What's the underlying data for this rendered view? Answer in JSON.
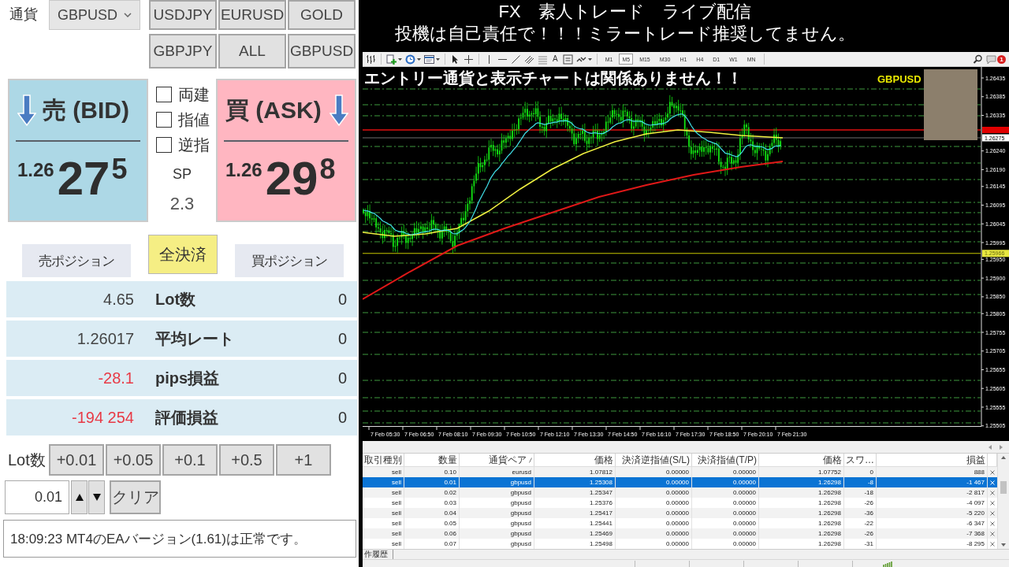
{
  "stream_header": {
    "title": "FX　素人トレード　ライブ配信",
    "subtitle": "投機は自己責任で！！！ミラートレード推奨してません。"
  },
  "order_panel": {
    "currency_label": "通貨",
    "currency_select": {
      "value": "GBPUSD"
    },
    "symbol_buttons": [
      "USDJPY",
      "EURUSD",
      "GOLD",
      "GBPJPY",
      "ALL",
      "GBPUSD"
    ],
    "bid": {
      "label": "売 (BID)",
      "price_prefix": "1.26",
      "price_main": "27",
      "price_pip": "5"
    },
    "order_options": [
      {
        "label": "両建",
        "checked": false
      },
      {
        "label": "指値",
        "checked": false
      },
      {
        "label": "逆指",
        "checked": false
      }
    ],
    "spread": {
      "label": "SP",
      "value": "2.3"
    },
    "ask": {
      "label": "買 (ASK)",
      "price_prefix": "1.26",
      "price_main": "29",
      "price_pip": "8"
    },
    "position_buttons": [
      {
        "label": "売ポジション",
        "kind": "sell"
      },
      {
        "label": "全決済",
        "kind": "close_all"
      },
      {
        "label": "買ポジション",
        "kind": "buy"
      }
    ],
    "summary_rows": [
      {
        "value": "4.65",
        "label": "Lot数",
        "count": "0",
        "negative": false
      },
      {
        "value": "1.26017",
        "label": "平均レート",
        "count": "0",
        "negative": false
      },
      {
        "value": "-28.1",
        "label": "pips損益",
        "count": "0",
        "negative": true
      },
      {
        "value": "-194 254",
        "label": "評価損益",
        "count": "0",
        "negative": true
      }
    ],
    "lot": {
      "label": "Lot数",
      "increments": [
        "+0.01",
        "+0.05",
        "+0.1",
        "+0.5",
        "+1"
      ],
      "value": "0.01",
      "clear_button": "クリア"
    },
    "status_message": "18:09:23 MT4のEAバージョン(1.61)は正常です。"
  },
  "terminal": {
    "toolbar": {
      "text_tool": "A",
      "timeframes": [
        {
          "label": "M1",
          "selected": false
        },
        {
          "label": "M5",
          "selected": true
        },
        {
          "label": "M15",
          "selected": false
        },
        {
          "label": "M30",
          "selected": false
        },
        {
          "label": "H1",
          "selected": false
        },
        {
          "label": "H4",
          "selected": false
        },
        {
          "label": "D1",
          "selected": false
        },
        {
          "label": "W1",
          "selected": false
        },
        {
          "label": "MN",
          "selected": false
        }
      ],
      "notification_count": "1"
    },
    "chart": {
      "overlay_note": "エントリー通貨と表示チャートは関係ありません！！",
      "symbol": "GBPUSD",
      "price_labels": [
        "1.26435",
        "1.26385",
        "1.26335",
        "1.26240",
        "1.26190",
        "1.26145",
        "1.26095",
        "1.26045",
        "1.25995",
        "1.25950",
        "1.25900",
        "1.25850",
        "1.25805",
        "1.25755",
        "1.25705",
        "1.25655",
        "1.25605",
        "1.25555",
        "1.25505"
      ],
      "bid_price": "1.26275",
      "level_price": "1.25966",
      "time_labels": [
        "7 Feb 05:30",
        "7 Feb 06:50",
        "7 Feb 08:10",
        "7 Feb 09:30",
        "7 Feb 10:50",
        "7 Feb 12:10",
        "7 Feb 13:30",
        "7 Feb 14:50",
        "7 Feb 16:10",
        "7 Feb 17:30",
        "7 Feb 18:50",
        "7 Feb 20:10",
        "7 Feb 21:30"
      ]
    },
    "trade_table": {
      "columns": [
        {
          "label": "取引種別",
          "sorted": false
        },
        {
          "label": "数量",
          "sorted": false
        },
        {
          "label": "通貨ペア",
          "sorted": true
        },
        {
          "label": "価格",
          "sorted": false
        },
        {
          "label": "決済逆指値(S/L)",
          "sorted": false
        },
        {
          "label": "決済指値(T/P)",
          "sorted": false
        },
        {
          "label": "価格",
          "sorted": false
        },
        {
          "label": "スワ…",
          "sorted": false
        },
        {
          "label": "損益",
          "sorted": false
        }
      ],
      "rows": [
        {
          "cells": [
            "sell",
            "0.10",
            "eurusd",
            "1.07812",
            "0.00000",
            "0.00000",
            "1.07752",
            "0",
            "888"
          ],
          "selected": false
        },
        {
          "cells": [
            "sell",
            "0.01",
            "gbpusd",
            "1.25308",
            "0.00000",
            "0.00000",
            "1.26298",
            "-8",
            "-1 467"
          ],
          "selected": true
        },
        {
          "cells": [
            "sell",
            "0.02",
            "gbpusd",
            "1.25347",
            "0.00000",
            "0.00000",
            "1.26298",
            "-18",
            "-2 817"
          ],
          "selected": false
        },
        {
          "cells": [
            "sell",
            "0.03",
            "gbpusd",
            "1.25376",
            "0.00000",
            "0.00000",
            "1.26298",
            "-26",
            "-4 097"
          ],
          "selected": false
        },
        {
          "cells": [
            "sell",
            "0.04",
            "gbpusd",
            "1.25417",
            "0.00000",
            "0.00000",
            "1.26298",
            "-36",
            "-5 220"
          ],
          "selected": false
        },
        {
          "cells": [
            "sell",
            "0.05",
            "gbpusd",
            "1.25441",
            "0.00000",
            "0.00000",
            "1.26298",
            "-22",
            "-6 347"
          ],
          "selected": false
        },
        {
          "cells": [
            "sell",
            "0.06",
            "gbpusd",
            "1.25469",
            "0.00000",
            "0.00000",
            "1.26298",
            "-26",
            "-7 368"
          ],
          "selected": false
        },
        {
          "cells": [
            "sell",
            "0.07",
            "gbpusd",
            "1.25498",
            "0.00000",
            "0.00000",
            "1.26298",
            "-31",
            "-8 295"
          ],
          "selected": false
        }
      ]
    },
    "bottom_tabs": [
      "作履歴"
    ]
  }
}
